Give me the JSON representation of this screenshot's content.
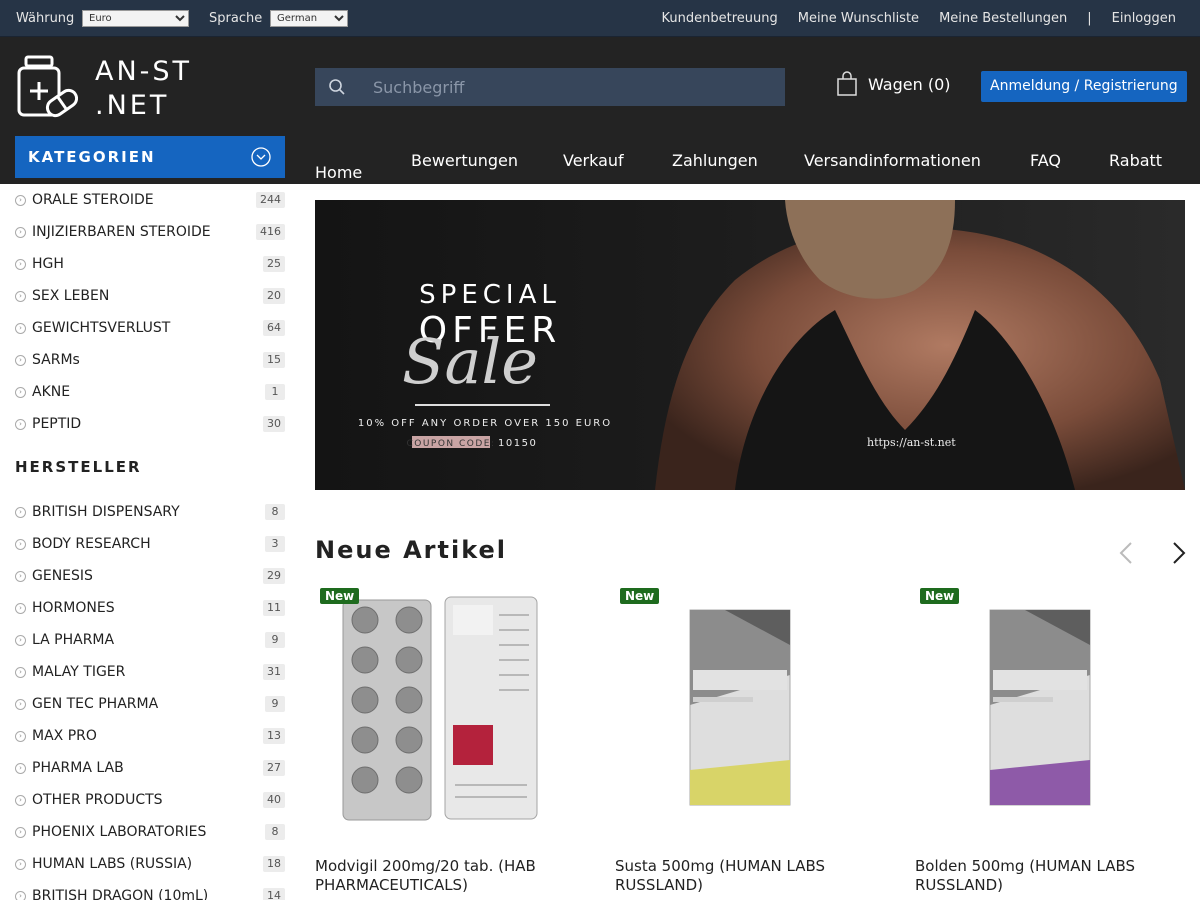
{
  "topbar": {
    "currency_label": "Währung",
    "currency_value": "Euro",
    "language_label": "Sprache",
    "language_value": "German",
    "links": [
      "Kundenbetreuung",
      "Meine Wunschliste",
      "Meine Bestellungen",
      "|",
      "Einloggen"
    ]
  },
  "header": {
    "logo_line1": "AN-ST",
    "logo_line2": ".NET",
    "search_placeholder": "Suchbegriff",
    "cart_label": "Wagen (0)",
    "login_label": "Anmeldung / Registrierung"
  },
  "nav": [
    "Home",
    "Bewertungen",
    "Verkauf",
    "Zahlungen",
    "Versandinformationen",
    "FAQ",
    "Rabatt"
  ],
  "sidebar": {
    "categories_title": "KATEGORIEN",
    "categories": [
      {
        "name": "ORALE STEROIDE",
        "count": "244"
      },
      {
        "name": "INJIZIERBAREN STEROIDE",
        "count": "416"
      },
      {
        "name": "HGH",
        "count": "25"
      },
      {
        "name": "SEX LEBEN",
        "count": "20"
      },
      {
        "name": "GEWICHTSVERLUST",
        "count": "64"
      },
      {
        "name": "SARMs",
        "count": "15"
      },
      {
        "name": "AKNE",
        "count": "1"
      },
      {
        "name": "PEPTID",
        "count": "30"
      }
    ],
    "manufacturers_title": "HERSTELLER",
    "manufacturers": [
      {
        "name": "BRITISH DISPENSARY",
        "count": "8"
      },
      {
        "name": "BODY RESEARCH",
        "count": "3"
      },
      {
        "name": "GENESIS",
        "count": "29"
      },
      {
        "name": "HORMONES",
        "count": "11"
      },
      {
        "name": "LA PHARMA",
        "count": "9"
      },
      {
        "name": "MALAY TIGER",
        "count": "31"
      },
      {
        "name": "GEN TEC PHARMA",
        "count": "9"
      },
      {
        "name": "MAX PRO",
        "count": "13"
      },
      {
        "name": "PHARMA LAB",
        "count": "27"
      },
      {
        "name": "OTHER PRODUCTS",
        "count": "40"
      },
      {
        "name": "PHOENIX LABORATORIES",
        "count": "8"
      },
      {
        "name": "HUMAN LABS (RUSSIA)",
        "count": "18"
      },
      {
        "name": "BRITISH DRAGON (10mL)",
        "count": "14"
      }
    ]
  },
  "banner": {
    "line1": "SPECIAL",
    "line2": "OFFER",
    "line3": "Sale",
    "line4": "10% OFF ANY ORDER OVER 150 EURO",
    "coupon_label": "COUPON CODE:",
    "coupon_code": "10150",
    "url": "https://an-st.net"
  },
  "new_articles": {
    "title": "Neue Artikel",
    "badge": "New",
    "products": [
      {
        "name": "Modvigil 200mg/20 tab. (HAB PHARMACEUTICALS)"
      },
      {
        "name": "Susta 500mg (HUMAN LABS RUSSLAND)"
      },
      {
        "name": "Bolden 500mg (HUMAN LABS RUSSLAND)"
      }
    ]
  },
  "colors": {
    "topbar": "#263446",
    "header": "#232323",
    "accent_blue": "#1565c0",
    "badge_green": "#1e6b1e"
  }
}
